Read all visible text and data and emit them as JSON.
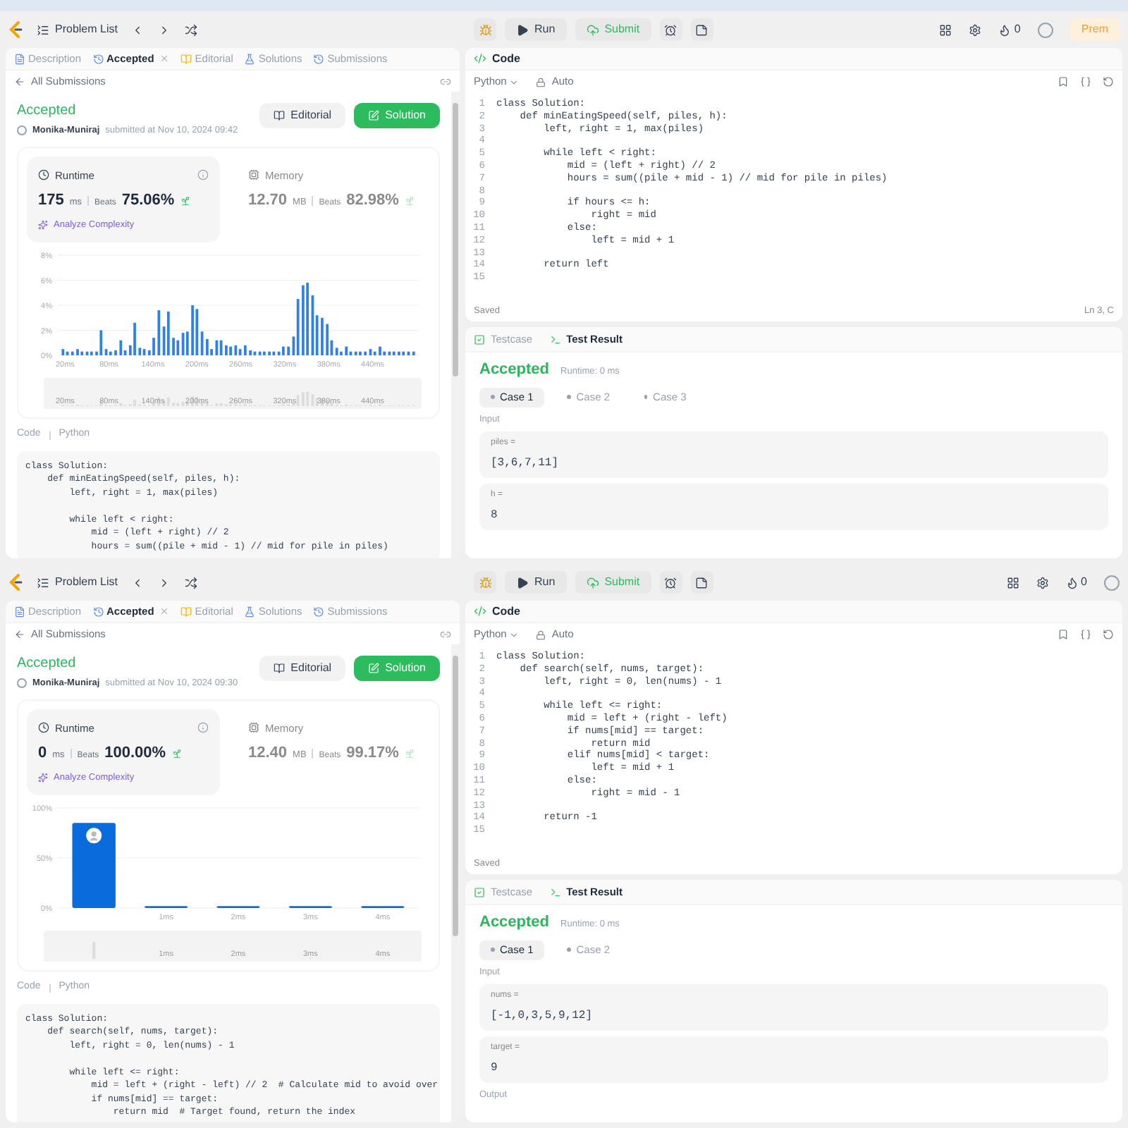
{
  "shots": [
    {
      "nav": {
        "problem_list": "Problem List",
        "run": "Run",
        "submit": "Submit",
        "streak": "0",
        "premium": "Prem"
      },
      "tabs": [
        {
          "label": "Description",
          "kind": "description",
          "selected": false,
          "closable": false
        },
        {
          "label": "Accepted",
          "kind": "accepted",
          "selected": true,
          "closable": true
        },
        {
          "label": "Editorial",
          "kind": "editorial",
          "selected": false,
          "closable": false
        },
        {
          "label": "Solutions",
          "kind": "solutions",
          "selected": false,
          "closable": false
        },
        {
          "label": "Submissions",
          "kind": "submissions",
          "selected": false,
          "closable": false
        }
      ],
      "back_link": "All Submissions",
      "status": "Accepted",
      "user": "Monika-Muniraj",
      "submitted": "submitted at Nov 10, 2024 09:42",
      "buttons": [
        {
          "label": "Editorial",
          "kind": "editorial"
        },
        {
          "label": "Solution",
          "kind": "solution"
        }
      ],
      "metrics": [
        {
          "label": "Runtime",
          "kind": "runtime",
          "value": "175",
          "unit": "ms",
          "beats_label": "Beats",
          "beats": "75.06%",
          "selected": true,
          "analyze": "Analyze Complexity"
        },
        {
          "label": "Memory",
          "kind": "memory",
          "value": "12.70",
          "unit": "MB",
          "beats_label": "Beats",
          "beats": "82.98%",
          "selected": false
        }
      ],
      "chart_data": {
        "type": "bar",
        "xlim": [
          10,
          503
        ],
        "ylim": [
          0,
          8
        ],
        "x": [
          17,
          23,
          30,
          37,
          43,
          50,
          56,
          63,
          69,
          76,
          82,
          89,
          96,
          102,
          109,
          115,
          122,
          128,
          135,
          141,
          148,
          155,
          161,
          168,
          174,
          181,
          187,
          194,
          200,
          207,
          214,
          220,
          227,
          233,
          240,
          246,
          253,
          259,
          266,
          273,
          279,
          286,
          292,
          299,
          305,
          312,
          318,
          325,
          332,
          338,
          345,
          351,
          358,
          364,
          371,
          378,
          384,
          391,
          397,
          404,
          410,
          417,
          423,
          430,
          437,
          443,
          450,
          456,
          463,
          469,
          476,
          482,
          489,
          496
        ],
        "grid": true,
        "series": [
          {
            "color": "#2f80ed",
            "values": [
              0.5,
              0.3,
              0.3,
              0.5,
              0.3,
              0.3,
              0.3,
              0.3,
              2.0,
              0.5,
              0.3,
              0.4,
              1.2,
              0.4,
              0.8,
              2.6,
              0.6,
              0.5,
              0.4,
              1.4,
              3.6,
              2.3,
              3.5,
              1.4,
              1.2,
              1.8,
              1.9,
              4.0,
              3.7,
              1.9,
              1.3,
              0.5,
              1.2,
              1.2,
              0.8,
              0.7,
              0.8,
              0.5,
              0.8,
              0.4,
              0.3,
              0.3,
              0.3,
              0.3,
              0.3,
              0.3,
              0.7,
              0.7,
              1.5,
              4.5,
              5.6,
              5.8,
              4.8,
              3.2,
              3.0,
              2.5,
              1.2,
              0.6,
              0.3,
              0.7,
              0.3,
              0.3,
              0.3,
              0.3,
              0.5,
              0.3,
              0.7,
              0.3,
              0.3,
              0.3,
              0.3,
              0.3,
              0.3,
              0.3
            ]
          }
        ],
        "xticks": [
          {
            "value": 20,
            "label": "20ms"
          },
          {
            "value": 80,
            "label": "80ms"
          },
          {
            "value": 140,
            "label": "140ms"
          },
          {
            "value": 200,
            "label": "200ms"
          },
          {
            "value": 260,
            "label": "260ms"
          },
          {
            "value": 320,
            "label": "320ms"
          },
          {
            "value": 380,
            "label": "380ms"
          },
          {
            "value": 440,
            "label": "440ms"
          }
        ],
        "yticks": [
          {
            "value": 0,
            "label": "0%"
          },
          {
            "value": 2,
            "label": "2%"
          },
          {
            "value": 4,
            "label": "4%"
          },
          {
            "value": 6,
            "label": "6%"
          },
          {
            "value": 8,
            "label": "8%"
          }
        ]
      },
      "overview_labels": [
        "20ms",
        "80ms",
        "140ms",
        "200ms",
        "260ms",
        "320ms",
        "380ms",
        "440ms"
      ],
      "code_meta": [
        "Code",
        "Python"
      ],
      "code_lines": [
        {
          "kind": "code",
          "text": "class Solution:"
        },
        {
          "kind": "code",
          "text": "    def minEatingSpeed(self, piles, h):"
        },
        {
          "kind": "code",
          "text": "        left, right = 1, max(piles)"
        },
        {
          "kind": "blank"
        },
        {
          "kind": "code",
          "text": "        while left < right:"
        },
        {
          "kind": "code",
          "text": "            mid = (left + right) // 2"
        },
        {
          "kind": "code",
          "text": "            hours = sum((pile + mid - 1) // mid for pile in piles)"
        }
      ],
      "editor": {
        "title": "Code",
        "language": "Python",
        "mode": "Auto",
        "saved": "Saved",
        "cursor": "Ln 3, C",
        "lines": [
          {
            "n": "1",
            "code": "class Solution:"
          },
          {
            "n": "2",
            "code": "    def minEatingSpeed(self, piles, h):"
          },
          {
            "n": "3",
            "code": "        left, right = 1, max(piles)"
          },
          {
            "n": "4"
          },
          {
            "n": "5",
            "code": "        while left < right:"
          },
          {
            "n": "6",
            "code": "            mid = (left + right) // 2"
          },
          {
            "n": "7",
            "code": "            hours = sum((pile + mid - 1) // mid for pile in piles)"
          },
          {
            "n": "8"
          },
          {
            "n": "9",
            "code": "            if hours <= h:"
          },
          {
            "n": "10",
            "code": "                right = mid"
          },
          {
            "n": "11",
            "code": "            else:"
          },
          {
            "n": "12",
            "code": "                left = mid + 1"
          },
          {
            "n": "13"
          },
          {
            "n": "14",
            "code": "        return left"
          },
          {
            "n": "15"
          }
        ]
      },
      "test_tabs": [
        {
          "label": "Testcase",
          "kind": "testcase",
          "selected": false
        },
        {
          "label": "Test Result",
          "kind": "result",
          "selected": true
        }
      ],
      "result": {
        "status": "Accepted",
        "runtime": "Runtime: 0 ms"
      },
      "cases": [
        {
          "label": "Case 1",
          "selected": true
        },
        {
          "label": "Case 2",
          "selected": false
        },
        {
          "label": "Case 3",
          "selected": false
        }
      ],
      "input_label": "Input",
      "inputs": [
        {
          "name": "piles =",
          "value": "[3,6,7,11]"
        },
        {
          "name": "h =",
          "value": "8"
        }
      ]
    },
    {
      "nav": {
        "problem_list": "Problem List",
        "run": "Run",
        "submit": "Submit",
        "streak": "0"
      },
      "tabs": [
        {
          "label": "Description",
          "kind": "description",
          "selected": false,
          "closable": false
        },
        {
          "label": "Accepted",
          "kind": "accepted",
          "selected": true,
          "closable": true
        },
        {
          "label": "Editorial",
          "kind": "editorial",
          "selected": false,
          "closable": false
        },
        {
          "label": "Solutions",
          "kind": "solutions",
          "selected": false,
          "closable": false
        },
        {
          "label": "Submissions",
          "kind": "submissions",
          "selected": false,
          "closable": false
        }
      ],
      "back_link": "All Submissions",
      "status": "Accepted",
      "user": "Monika-Muniraj",
      "submitted": "submitted at Nov 10, 2024 09:30",
      "buttons": [
        {
          "label": "Editorial",
          "kind": "editorial"
        },
        {
          "label": "Solution",
          "kind": "solution"
        }
      ],
      "metrics": [
        {
          "label": "Runtime",
          "kind": "runtime",
          "value": "0",
          "unit": "ms",
          "beats_label": "Beats",
          "beats": "100.00%",
          "selected": true,
          "analyze": "Analyze Complexity"
        },
        {
          "label": "Memory",
          "kind": "memory",
          "value": "12.40",
          "unit": "MB",
          "beats_label": "Beats",
          "beats": "99.17%",
          "selected": false
        }
      ],
      "chart_data": {
        "type": "bar",
        "xlim": [
          -0.5,
          4.5
        ],
        "ylim": [
          0,
          100
        ],
        "x": [
          0,
          1,
          2,
          3,
          4
        ],
        "grid": true,
        "series": [
          {
            "color": "#0a6cdc",
            "values": [
              85,
              2,
              2,
              2,
              2
            ]
          }
        ],
        "xticks": [
          {
            "value": 1,
            "label": "1ms"
          },
          {
            "value": 2,
            "label": "2ms"
          },
          {
            "value": 3,
            "label": "3ms"
          },
          {
            "value": 4,
            "label": "4ms"
          }
        ],
        "yticks": [
          {
            "value": 0,
            "label": "0%"
          },
          {
            "value": 50,
            "label": "50%"
          },
          {
            "value": 100,
            "label": "100%"
          }
        ]
      },
      "user_marker": true,
      "overview_labels": [
        "1ms",
        "2ms",
        "3ms",
        "4ms"
      ],
      "code_meta": [
        "Code",
        "Python"
      ],
      "code_lines": [
        {
          "kind": "code",
          "text": "class Solution:"
        },
        {
          "kind": "code",
          "text": "    def search(self, nums, target):"
        },
        {
          "kind": "code",
          "text": "        left, right = 0, len(nums) - 1"
        },
        {
          "kind": "blank"
        },
        {
          "kind": "code",
          "text": "        while left <= right:"
        },
        {
          "kind": "code",
          "text": "            mid = left + (right - left) // 2  # Calculate mid to avoid over"
        },
        {
          "kind": "code",
          "text": "            if nums[mid] == target:"
        },
        {
          "kind": "code",
          "text": "                return mid  # Target found, return the index"
        }
      ],
      "editor": {
        "title": "Code",
        "language": "Python",
        "mode": "Auto",
        "saved": "Saved",
        "lines": [
          {
            "n": "1",
            "code": "class Solution:"
          },
          {
            "n": "2",
            "code": "    def search(self, nums, target):"
          },
          {
            "n": "3",
            "code": "        left, right = 0, len(nums) - 1"
          },
          {
            "n": "4"
          },
          {
            "n": "5",
            "code": "        while left <= right:"
          },
          {
            "n": "6",
            "code": "            mid = left + (right - left)"
          },
          {
            "n": "7",
            "code": "            if nums[mid] == target:"
          },
          {
            "n": "8",
            "code": "                return mid"
          },
          {
            "n": "9",
            "code": "            elif nums[mid] < target:"
          },
          {
            "n": "10",
            "code": "                left = mid + 1"
          },
          {
            "n": "11",
            "code": "            else:"
          },
          {
            "n": "12",
            "code": "                right = mid - 1"
          },
          {
            "n": "13"
          },
          {
            "n": "14",
            "code": "        return -1"
          },
          {
            "n": "15"
          }
        ]
      },
      "test_tabs": [
        {
          "label": "Testcase",
          "kind": "testcase",
          "selected": false
        },
        {
          "label": "Test Result",
          "kind": "result",
          "selected": true
        }
      ],
      "result": {
        "status": "Accepted",
        "runtime": "Runtime: 0 ms"
      },
      "cases": [
        {
          "label": "Case 1",
          "selected": true
        },
        {
          "label": "Case 2",
          "selected": false
        }
      ],
      "input_label": "Input",
      "inputs": [
        {
          "name": "nums =",
          "value": "[-1,0,3,5,9,12]"
        },
        {
          "name": "target =",
          "value": "9"
        }
      ],
      "output_label": "Output"
    }
  ]
}
